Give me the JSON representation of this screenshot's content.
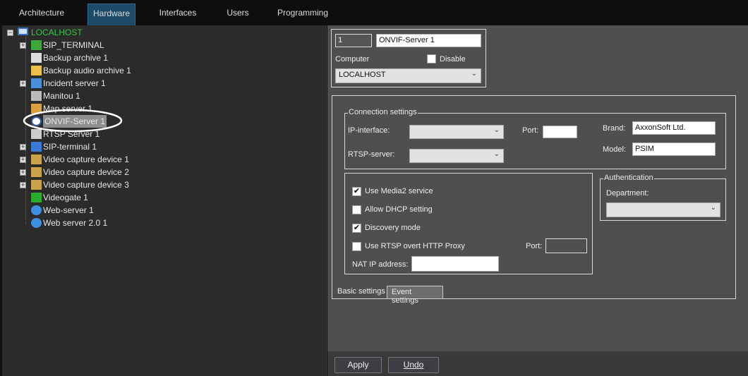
{
  "tabs": [
    {
      "label": "Architecture"
    },
    {
      "label": "Hardware",
      "active": true
    },
    {
      "label": "Interfaces"
    },
    {
      "label": "Users"
    },
    {
      "label": "Programming"
    }
  ],
  "tree": {
    "root": "LOCALHOST",
    "items": [
      {
        "label": "SIP_TERMINAL",
        "icon": "board-icon",
        "expandable": true
      },
      {
        "label": "Backup archive 1",
        "icon": "archive-icon"
      },
      {
        "label": "Backup audio archive 1",
        "icon": "audio-archive-icon"
      },
      {
        "label": "Incident server 1",
        "icon": "incident-icon",
        "expandable": true
      },
      {
        "label": "Manitou 1",
        "icon": "manitou-icon"
      },
      {
        "label": "Map server 1",
        "icon": "map-icon"
      },
      {
        "label": "ONVIF-Server 1",
        "icon": "onvif-icon",
        "selected": true
      },
      {
        "label": "RTSP Server 1",
        "icon": "rtsp-icon"
      },
      {
        "label": "SIP-terminal 1",
        "icon": "sip-icon",
        "expandable": true
      },
      {
        "label": "Video capture device 1",
        "icon": "chip-icon",
        "expandable": true
      },
      {
        "label": "Video capture device 2",
        "icon": "chip-icon",
        "expandable": true
      },
      {
        "label": "Video capture device 3",
        "icon": "chip-icon",
        "expandable": true
      },
      {
        "label": "Videogate 1",
        "icon": "videogate-icon"
      },
      {
        "label": "Web-server 1",
        "icon": "globe-icon"
      },
      {
        "label": "Web server 2.0 1",
        "icon": "globe-icon"
      }
    ]
  },
  "header": {
    "id": "1",
    "name": "ONVIF-Server 1",
    "computer_label": "Computer",
    "disable_label": "Disable",
    "disable_checked": false,
    "computer_value": "LOCALHOST"
  },
  "connection": {
    "title": "Connection settings",
    "ip_label": "IP-interface:",
    "ip_value": "",
    "rtsp_label": "RTSP-server:",
    "rtsp_value": "",
    "port_label": "Port:",
    "port_value": "",
    "brand_label": "Brand:",
    "brand_value": "AxxonSoft Ltd.",
    "model_label": "Model:",
    "model_value": "PSIM"
  },
  "options": {
    "media2": "Use Media2 service",
    "dhcp": "Allow DHCP setting",
    "discovery": "Discovery mode",
    "rtsp_proxy": "Use RTSP overt HTTP Proxy",
    "port_label": "Port:",
    "port_value": "",
    "nat_label": "NAT IP address:",
    "nat_value": ""
  },
  "auth": {
    "title": "Authentication",
    "dept_label": "Department:",
    "dept_value": ""
  },
  "subtabs": {
    "basic": "Basic settings",
    "event": "Event settings"
  },
  "buttons": {
    "apply": "Apply",
    "undo": "Undo"
  },
  "colors": {
    "accent_tab": "#1d4a66",
    "root_text": "#2ecc40"
  }
}
